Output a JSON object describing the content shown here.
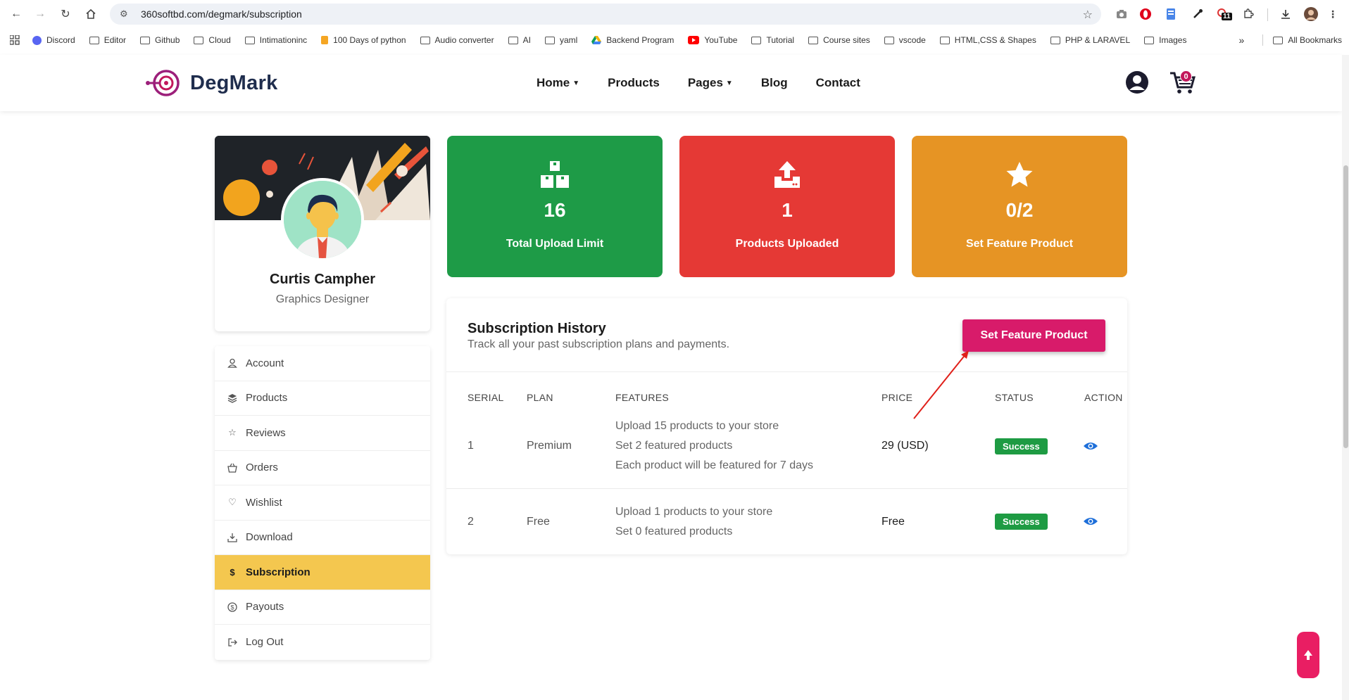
{
  "browser": {
    "url": "360softbd.com/degmark/subscription",
    "ext_badge": "11",
    "bookmarks": [
      "Discord",
      "Editor",
      "Github",
      "Cloud",
      "Intimationinc",
      "100 Days of python",
      "Audio converter",
      "AI",
      "yaml",
      "Backend Program",
      "YouTube",
      "Tutorial",
      "Course sites",
      "vscode",
      "HTML,CSS & Shapes",
      "PHP & LARAVEL",
      "Images"
    ],
    "all_bookmarks": "All Bookmarks",
    "overflow": "»"
  },
  "site": {
    "logo": "DegMark",
    "nav": {
      "home": "Home",
      "products": "Products",
      "pages": "Pages",
      "blog": "Blog",
      "contact": "Contact"
    },
    "cart_count": "0"
  },
  "profile": {
    "name": "Curtis Campher",
    "role": "Graphics Designer"
  },
  "menu": [
    {
      "label": "Account",
      "icon": "user-icon"
    },
    {
      "label": "Products",
      "icon": "layers-icon"
    },
    {
      "label": "Reviews",
      "icon": "star-icon"
    },
    {
      "label": "Orders",
      "icon": "basket-icon"
    },
    {
      "label": "Wishlist",
      "icon": "heart-icon"
    },
    {
      "label": "Download",
      "icon": "download-icon"
    },
    {
      "label": "Subscription",
      "icon": "dollar-icon",
      "active": true
    },
    {
      "label": "Payouts",
      "icon": "coin-icon"
    },
    {
      "label": "Log Out",
      "icon": "logout-icon"
    }
  ],
  "stats": [
    {
      "value": "16",
      "label": "Total Upload Limit",
      "color": "#1e9b47",
      "icon": "boxes-icon"
    },
    {
      "value": "1",
      "label": "Products Uploaded",
      "color": "#e53935",
      "icon": "upload-icon"
    },
    {
      "value": "0/2",
      "label": "Set Feature Product",
      "color": "#e69424",
      "icon": "star-icon"
    }
  ],
  "history": {
    "title": "Subscription History",
    "subtitle": "Track all your past subscription plans and payments.",
    "button": "Set Feature Product",
    "headers": [
      "SERIAL",
      "PLAN",
      "FEATURES",
      "PRICE",
      "STATUS",
      "ACTION"
    ],
    "rows": [
      {
        "serial": "1",
        "plan": "Premium",
        "features": [
          "Upload 15 products to your store",
          "Set 2 featured products",
          "Each product will be featured for 7 days"
        ],
        "price": "29 (USD)",
        "status": "Success"
      },
      {
        "serial": "2",
        "plan": "Free",
        "features": [
          "Upload 1 products to your store",
          "Set 0 featured products"
        ],
        "price": "Free",
        "status": "Success"
      }
    ]
  },
  "colors": {
    "accent": "#d81b6a",
    "active_menu": "#f4c74f",
    "success": "#1e9b43",
    "eye": "#1e6fd9"
  }
}
